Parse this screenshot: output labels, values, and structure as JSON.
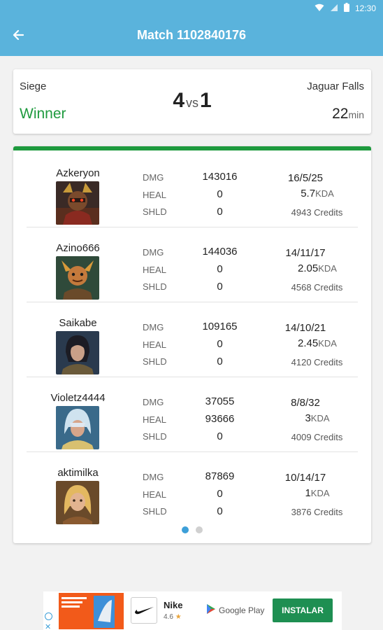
{
  "status_bar": {
    "time": "12:30"
  },
  "app_bar": {
    "title": "Match 1102840176"
  },
  "summary": {
    "mode": "Siege",
    "result": "Winner",
    "score_left": "4",
    "vs": "vs",
    "score_right": "1",
    "map": "Jaguar Falls",
    "duration": "22",
    "duration_unit": "min"
  },
  "labels": {
    "dmg": "DMG",
    "heal": "HEAL",
    "shld": "SHLD",
    "kda_unit": "KDA"
  },
  "players": [
    {
      "name": "Azkeryon",
      "dmg": "143016",
      "heal": "0",
      "shld": "0",
      "kda": "16/5/25",
      "kda_ratio": "5.7",
      "credits": "4943 Credits"
    },
    {
      "name": "Azino666",
      "dmg": "144036",
      "heal": "0",
      "shld": "0",
      "kda": "14/11/17",
      "kda_ratio": "2.05",
      "credits": "4568 Credits"
    },
    {
      "name": "Saikabe",
      "dmg": "109165",
      "heal": "0",
      "shld": "0",
      "kda": "14/10/21",
      "kda_ratio": "2.45",
      "credits": "4120 Credits"
    },
    {
      "name": "Violetz4444",
      "dmg": "37055",
      "heal": "93666",
      "shld": "0",
      "kda": "8/8/32",
      "kda_ratio": "3",
      "credits": "4009 Credits"
    },
    {
      "name": "aktimilka",
      "dmg": "87869",
      "heal": "0",
      "shld": "0",
      "kda": "10/14/17",
      "kda_ratio": "1",
      "credits": "3876 Credits"
    }
  ],
  "pager": {
    "pages": 2,
    "active": 0
  },
  "ad": {
    "name": "Nike",
    "rating": "4.6",
    "store": "Google Play",
    "cta": "INSTALAR"
  }
}
